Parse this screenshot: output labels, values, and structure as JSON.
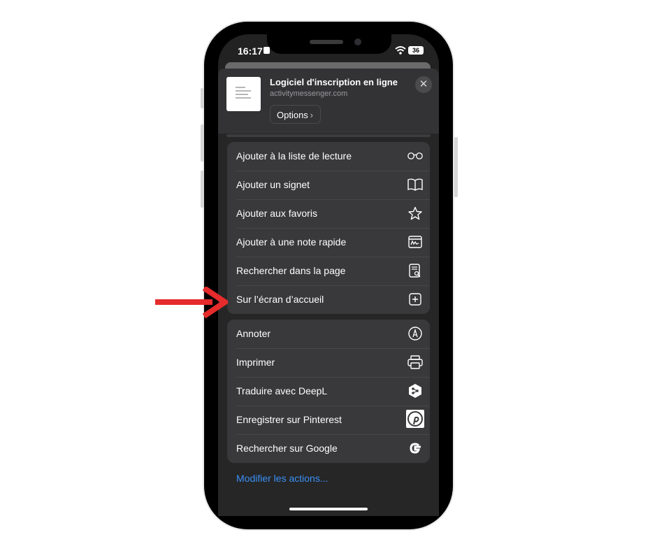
{
  "status_bar": {
    "time": "16:17",
    "battery": "36"
  },
  "header": {
    "title": "Logiciel d'inscription en ligne",
    "url": "activitymessenger.com",
    "options_label": "Options",
    "options_chevron": "›",
    "close_symbol": "✕"
  },
  "group1": [
    {
      "label": "Ajouter à la liste de lecture",
      "icon": "glasses-icon"
    },
    {
      "label": "Ajouter un signet",
      "icon": "book-icon"
    },
    {
      "label": "Ajouter aux favoris",
      "icon": "star-icon"
    },
    {
      "label": "Ajouter à une note rapide",
      "icon": "quick-note-icon"
    },
    {
      "label": "Rechercher dans la page",
      "icon": "find-in-page-icon"
    },
    {
      "label": "Sur l’écran d’accueil",
      "icon": "add-square-icon"
    }
  ],
  "group2": [
    {
      "label": "Annoter",
      "icon": "markup-pen-icon"
    },
    {
      "label": "Imprimer",
      "icon": "printer-icon"
    },
    {
      "label": "Traduire avec DeepL",
      "icon": "deepl-icon"
    },
    {
      "label": "Enregistrer sur Pinterest",
      "icon": "pinterest-icon"
    },
    {
      "label": "Rechercher sur Google",
      "icon": "google-icon"
    }
  ],
  "footer": {
    "modify_actions": "Modifier les actions..."
  },
  "colors": {
    "accent_link": "#3a8ff5",
    "arrow": "#e52b2b",
    "sheet_bg": "#262626"
  }
}
